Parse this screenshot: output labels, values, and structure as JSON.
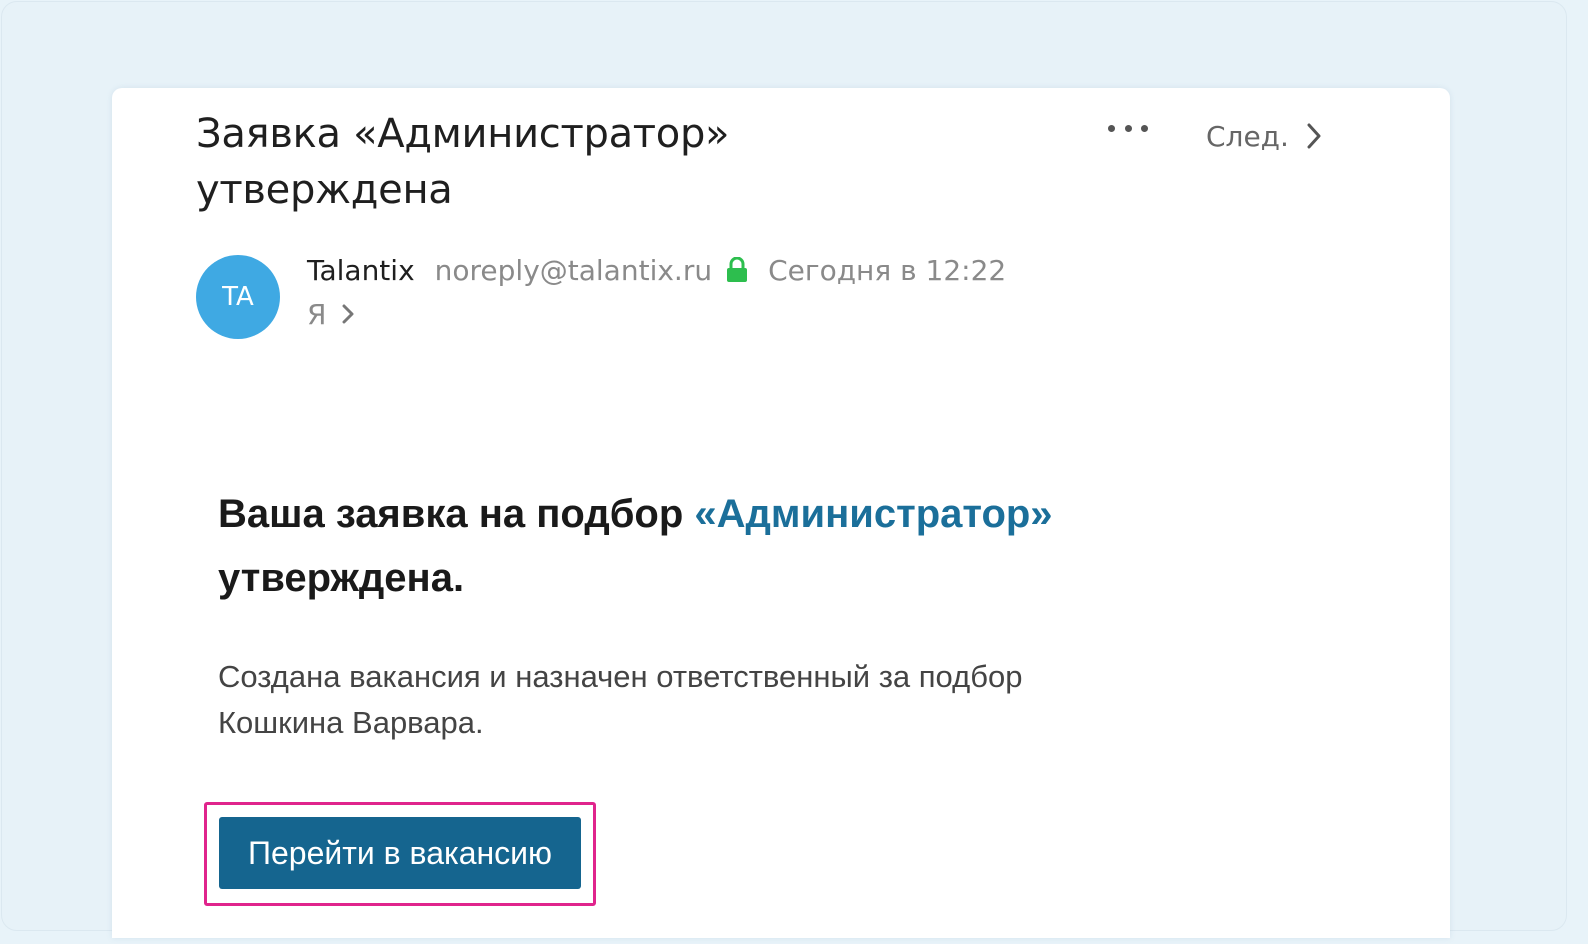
{
  "email": {
    "subject": "Заявка «Администратор» утверждена",
    "next_label": "След.",
    "sender": {
      "initials": "TA",
      "name": "Talantix",
      "email": "noreply@talantix.ru",
      "time": "Сегодня в 12:22",
      "recipient": "Я"
    },
    "body": {
      "title_prefix": "Ваша заявка на подбор ",
      "title_link": "«Администратор»",
      "title_suffix": " утверждена.",
      "text": "Создана вакансия и назначен ответственный за подбор Кошкина Варвара.",
      "button_label": "Перейти в вакансию"
    }
  },
  "colors": {
    "background": "#e8f3f9",
    "avatar": "#3fa9e3",
    "link": "#1b6f9a",
    "button": "#15658f",
    "highlight": "#e0248c",
    "lock": "#2dbe4e"
  }
}
